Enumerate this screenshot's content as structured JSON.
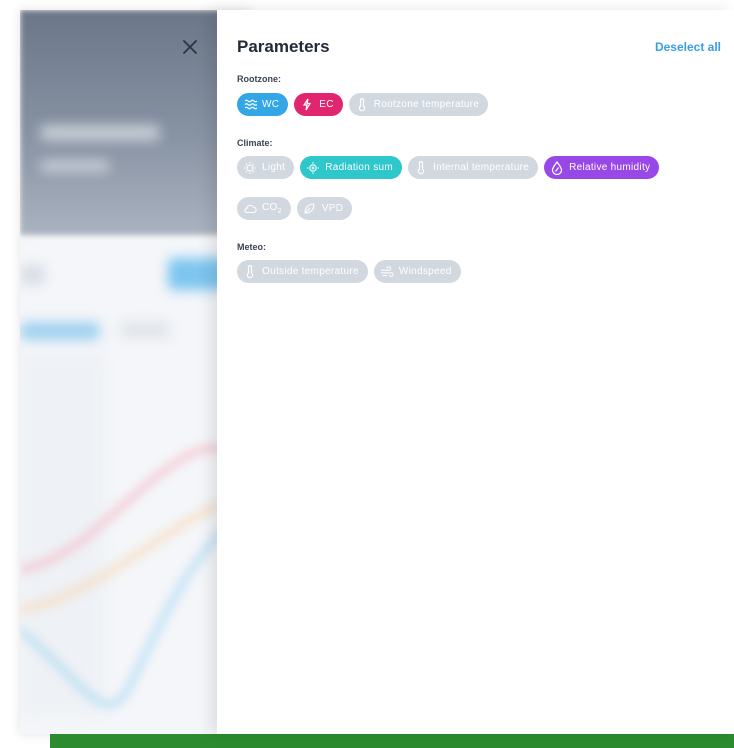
{
  "panel": {
    "title": "Parameters",
    "deselect_label": "Deselect all"
  },
  "sections": {
    "rootzone": {
      "label": "Rootzone:",
      "chips": [
        {
          "label": "WC",
          "icon": "waves-icon",
          "selected": true,
          "color": "#33a6e6"
        },
        {
          "label": "EC",
          "icon": "lightning-icon",
          "selected": true,
          "color": "#e2256f"
        },
        {
          "label": "Rootzone temperature",
          "icon": "thermometer-icon",
          "selected": false,
          "color": "#d2d8e0"
        }
      ]
    },
    "climate": {
      "label": "Climate:",
      "chips": [
        {
          "label": "Light",
          "icon": "sun-icon",
          "selected": false,
          "color": "#d2d8e0"
        },
        {
          "label": "Radiation sum",
          "icon": "radiation-sun-icon",
          "selected": true,
          "color": "#2ec7cc"
        },
        {
          "label": "Internal temperature",
          "icon": "thermometer-icon",
          "selected": false,
          "color": "#d2d8e0"
        },
        {
          "label": "Relative humidity",
          "icon": "droplet-icon",
          "selected": true,
          "color": "#9948e8"
        },
        {
          "label": "CO",
          "subscript": "2",
          "icon": "cloud-icon",
          "selected": false,
          "color": "#d2d8e0"
        },
        {
          "label": "VPD",
          "icon": "leaf-drop-icon",
          "selected": false,
          "color": "#d2d8e0"
        }
      ]
    },
    "meteo": {
      "label": "Meteo:",
      "chips": [
        {
          "label": "Outside temperature",
          "icon": "thermometer-icon",
          "selected": false,
          "color": "#d2d8e0"
        },
        {
          "label": "Windspeed",
          "icon": "wind-icon",
          "selected": false,
          "color": "#d2d8e0"
        }
      ]
    }
  }
}
